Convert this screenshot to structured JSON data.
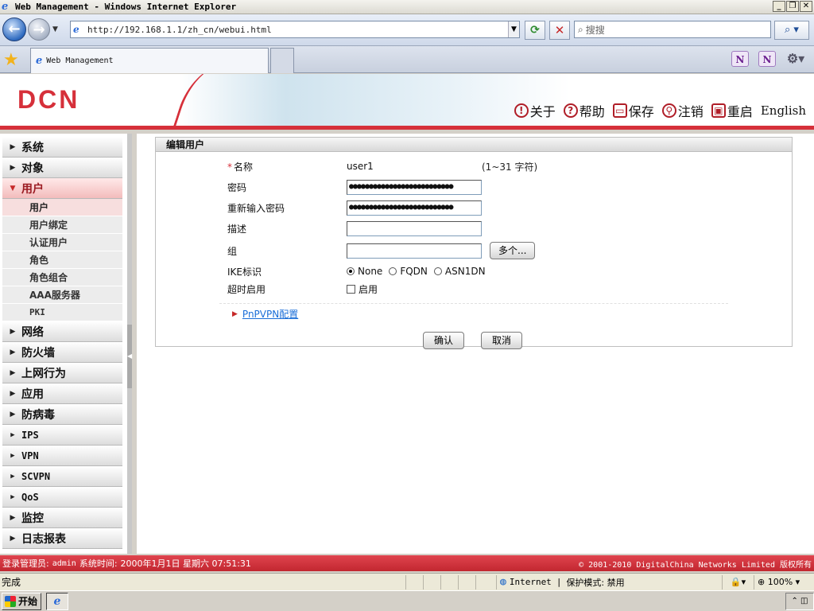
{
  "browser": {
    "window_title": "Web Management - Windows Internet Explorer",
    "url": "http://192.168.1.1/zh_cn/webui.html",
    "search_placeholder": "搜搜",
    "tab_title": "Web Management",
    "status_text": "完成",
    "zone_text": "Internet",
    "protected_mode": "保护模式: 禁用",
    "zoom": "100%"
  },
  "app": {
    "logo": "DCN",
    "header_links": [
      {
        "label": "关于",
        "icon": "info-icon"
      },
      {
        "label": "帮助",
        "icon": "help-icon"
      },
      {
        "label": "保存",
        "icon": "save-icon"
      },
      {
        "label": "注销",
        "icon": "logout-icon"
      },
      {
        "label": "重启",
        "icon": "reboot-icon"
      },
      {
        "label": "English",
        "icon": ""
      }
    ]
  },
  "sidebar": {
    "top_items": [
      {
        "label": "系统"
      },
      {
        "label": "对象"
      },
      {
        "label": "用户"
      }
    ],
    "user_subitems": [
      {
        "label": "用户"
      },
      {
        "label": "用户绑定"
      },
      {
        "label": "认证用户"
      },
      {
        "label": "角色"
      },
      {
        "label": "角色组合"
      },
      {
        "label": "AAA服务器"
      },
      {
        "label": "PKI"
      }
    ],
    "bottom_items": [
      {
        "label": "网络"
      },
      {
        "label": "防火墙"
      },
      {
        "label": "上网行为"
      },
      {
        "label": "应用"
      },
      {
        "label": "防病毒"
      },
      {
        "label": "IPS"
      },
      {
        "label": "VPN"
      },
      {
        "label": "SCVPN"
      },
      {
        "label": "QoS"
      },
      {
        "label": "监控"
      },
      {
        "label": "日志报表"
      }
    ]
  },
  "form": {
    "panel_title": "编辑用户",
    "name_label": "名称",
    "name_value": "user1",
    "name_hint": "(1~31 字符)",
    "password_label": "密码",
    "password_value": "●●●●●●●●●●●●●●●●●●●●●●●●●●",
    "confirm_label": "重新输入密码",
    "confirm_value": "●●●●●●●●●●●●●●●●●●●●●●●●●●",
    "desc_label": "描述",
    "desc_value": "",
    "group_label": "组",
    "group_value": "",
    "more_button": "多个...",
    "ike_label": "IKE标识",
    "ike_options": [
      "None",
      "FQDN",
      "ASN1DN"
    ],
    "ike_selected": "None",
    "timeout_label": "超时启用",
    "timeout_checkbox_label": "启用",
    "timeout_checked": false,
    "pnpvpn_link": "PnPVPN配置",
    "ok_button": "确认",
    "cancel_button": "取消"
  },
  "footer": {
    "login_label": "登录管理员:",
    "login_user": "admin",
    "time_label": "系统时间:",
    "time_value": "2000年1月1日 星期六 07:51:31",
    "copyright": "© 2001-2010 DigitalChina Networks Limited 版权所有"
  },
  "taskbar": {
    "start_label": "开始"
  }
}
